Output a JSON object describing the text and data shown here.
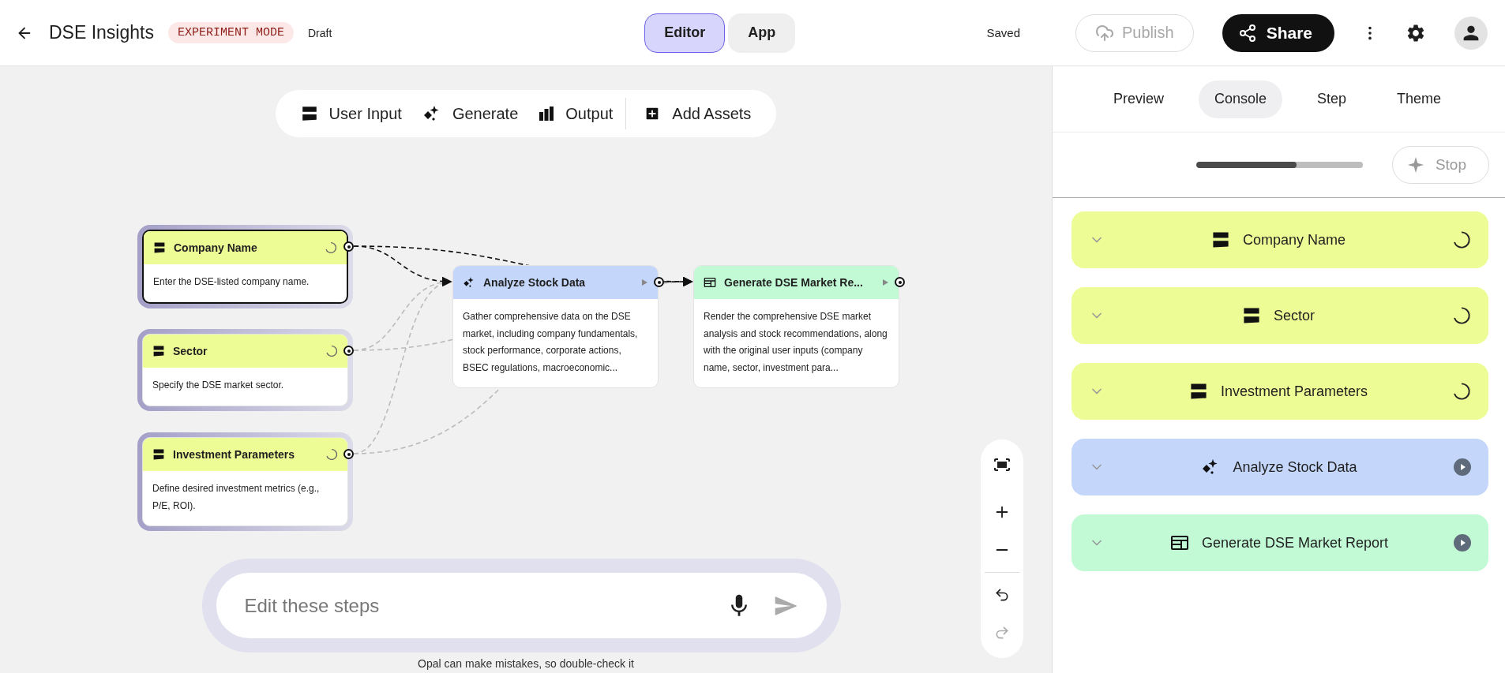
{
  "header": {
    "title": "DSE Insights",
    "badge": "EXPERIMENT MODE",
    "status": "Draft",
    "mode_tabs": [
      {
        "label": "Editor",
        "selected": true
      },
      {
        "label": "App",
        "selected": false
      }
    ],
    "save_status": "Saved",
    "publish": {
      "label": "Publish",
      "disabled": true
    },
    "share": {
      "label": "Share"
    }
  },
  "toolbar": {
    "items": [
      {
        "kind": "input",
        "label": "User Input"
      },
      {
        "kind": "generate",
        "label": "Generate"
      },
      {
        "kind": "output",
        "label": "Output"
      },
      {
        "kind": "add",
        "label": "Add Assets"
      }
    ]
  },
  "nodes": [
    {
      "kind": "input",
      "title": "Company Name",
      "description": "Enter the DSE-listed company name.",
      "color": "#eefc96",
      "running": true,
      "selected": true
    },
    {
      "kind": "input",
      "title": "Sector",
      "description": "Specify the DSE market sector.",
      "color": "#eefc96",
      "running": true,
      "selected": false
    },
    {
      "kind": "input",
      "title": "Investment Parameters",
      "description": "Define desired investment metrics (e.g., P/E, ROI).",
      "color": "#eefc96",
      "running": true,
      "selected": false
    },
    {
      "kind": "generate",
      "title": "Analyze Stock Data",
      "description": "Gather comprehensive data on the DSE market, including company fundamentals, stock performance, corporate actions, BSEC regulations, macroeconomic...",
      "color": "#c4d7fb",
      "running": false,
      "selected": false
    },
    {
      "kind": "output",
      "title": "Generate DSE Market Re...",
      "description": "Render the comprehensive DSE market analysis and stock recommendations, along with the original user inputs (company name, sector, investment para...",
      "color": "#c2fad6",
      "running": false,
      "selected": false
    }
  ],
  "prompt": {
    "placeholder": "Edit these steps"
  },
  "footer_note": "Opal can make mistakes, so double-check it",
  "panel": {
    "tabs": [
      {
        "label": "Preview",
        "selected": false
      },
      {
        "label": "Console",
        "selected": true
      },
      {
        "label": "Step",
        "selected": false
      },
      {
        "label": "Theme",
        "selected": false
      }
    ],
    "progress": {
      "level": 0.6
    },
    "stop": {
      "label": "Stop",
      "disabled": true
    },
    "steps": [
      {
        "kind": "input",
        "title": "Company Name",
        "color": "#eefc96",
        "running": true
      },
      {
        "kind": "input",
        "title": "Sector",
        "color": "#eefc96",
        "running": true
      },
      {
        "kind": "input",
        "title": "Investment Parameters",
        "color": "#eefc96",
        "running": true
      },
      {
        "kind": "generate",
        "title": "Analyze Stock Data",
        "color": "#c4d7fb",
        "running": false
      },
      {
        "kind": "output",
        "title": "Generate DSE Market Report",
        "color": "#c2fad6",
        "running": false
      }
    ]
  }
}
